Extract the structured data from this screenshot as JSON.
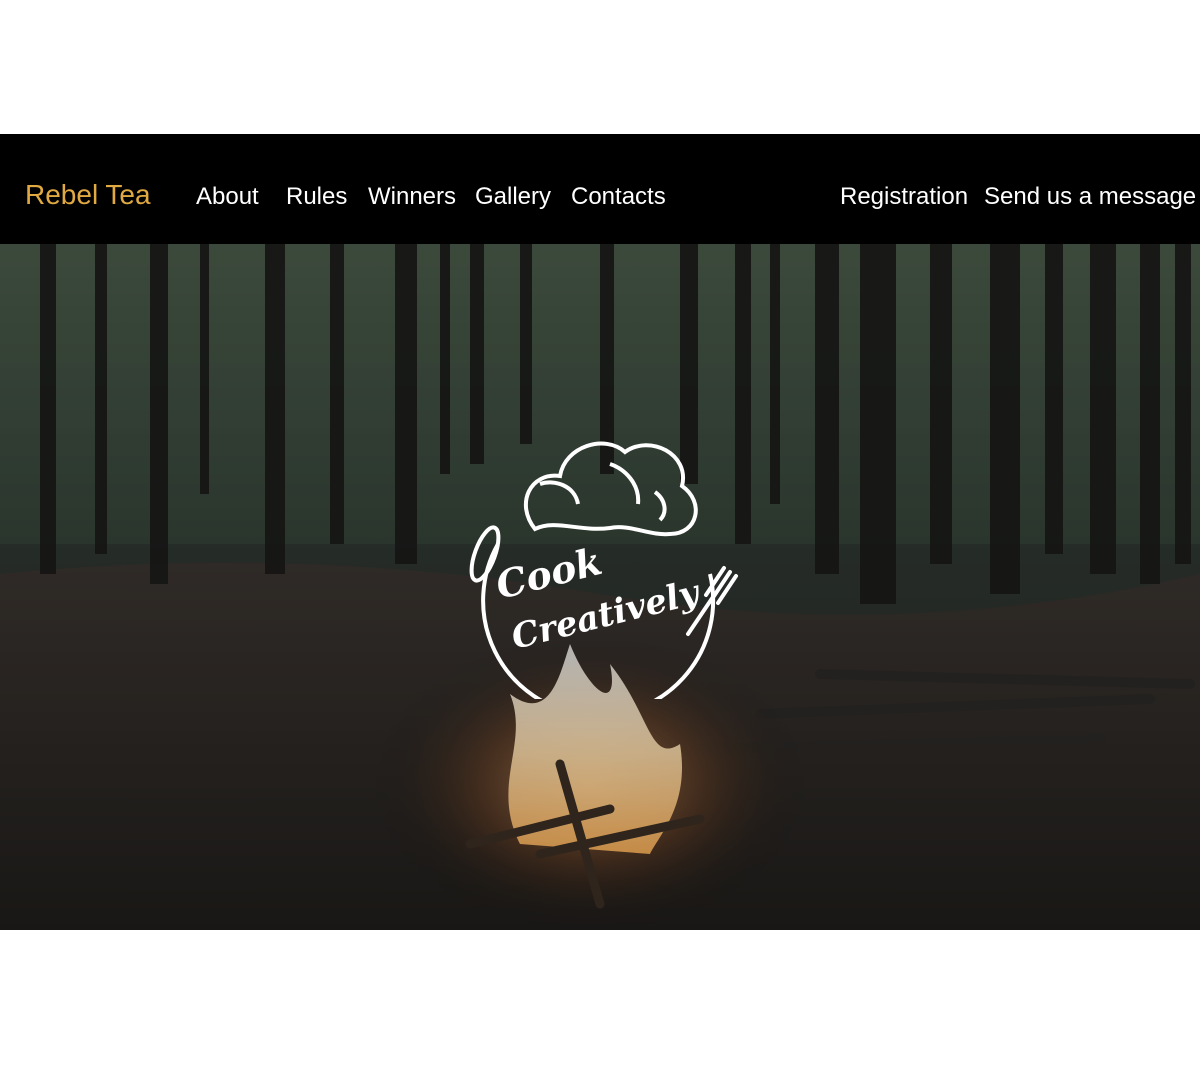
{
  "nav": {
    "brand": "Rebel Tea",
    "links": [
      "About",
      "Rules",
      "Winners",
      "Gallery",
      "Contacts"
    ],
    "right_links": [
      "Registration",
      "Send us a message"
    ]
  },
  "hero": {
    "logo": {
      "line1": "Cook",
      "line2": "Creatively"
    }
  },
  "colors": {
    "navbar_bg": "#000000",
    "brand": "#e0a941",
    "nav_text": "#ffffff",
    "page_bg": "#ffffff"
  },
  "icons": [
    "chef-hat-icon",
    "fork-icon",
    "spoon-icon"
  ]
}
